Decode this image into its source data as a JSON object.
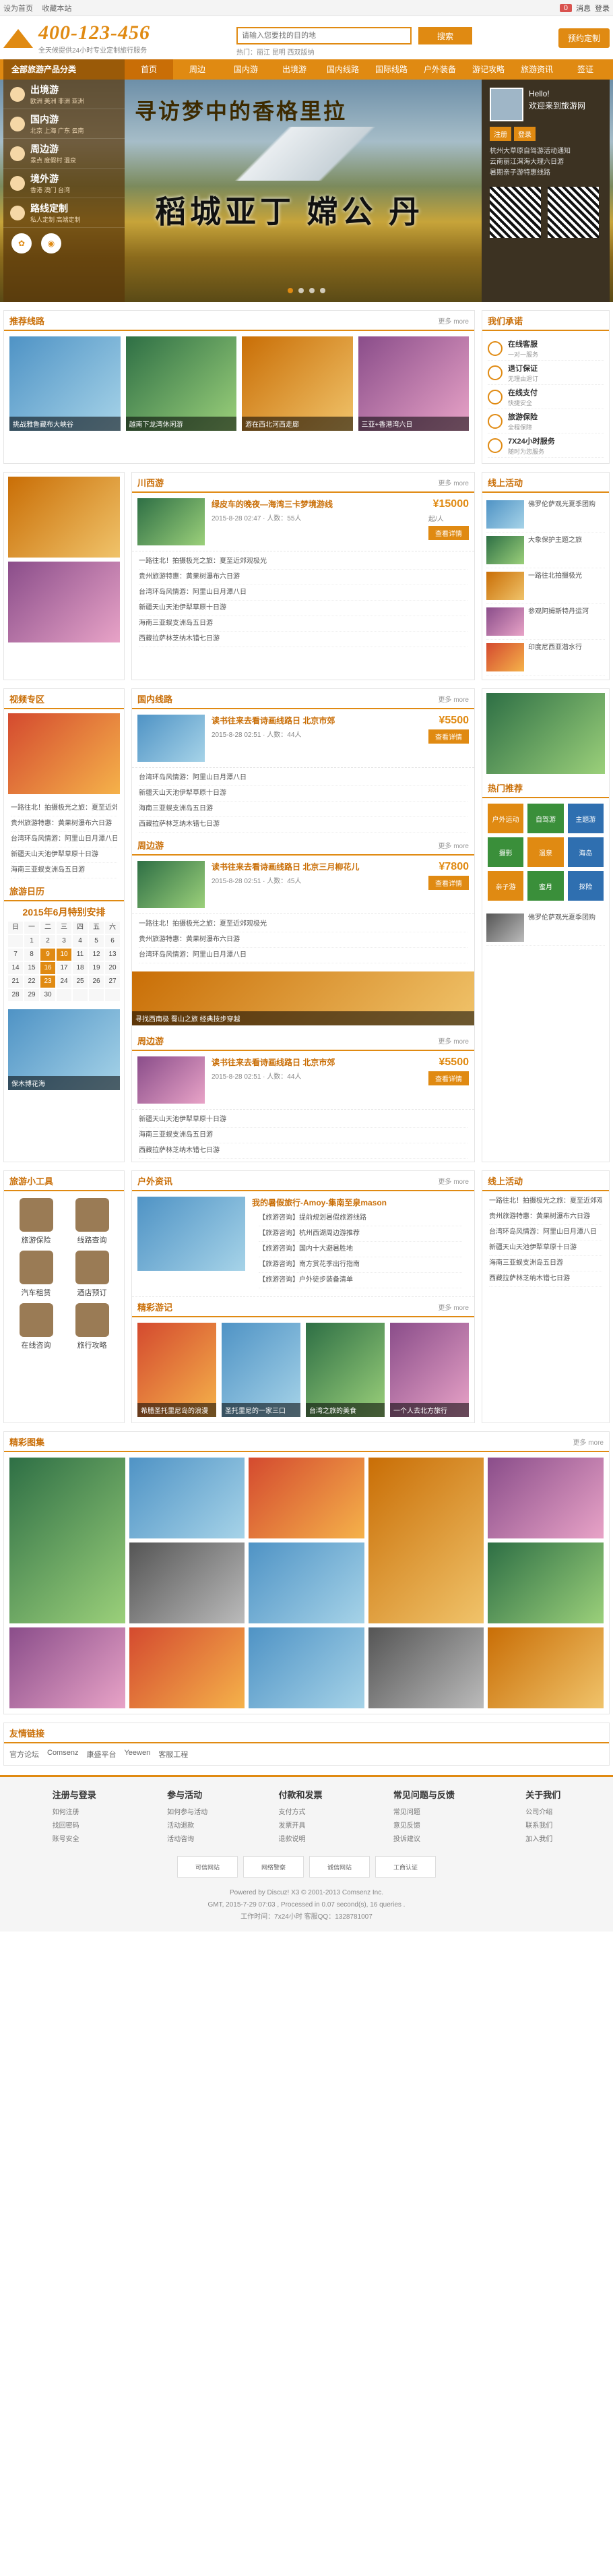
{
  "topbar": {
    "left": [
      "设为首页",
      "收藏本站"
    ],
    "user": "登录",
    "msg": "消息",
    "msgcount": "0"
  },
  "header": {
    "phone": "400-123-456",
    "phone_sub": "全天候提供24小时专业定制旅行服务",
    "search_placeholder": "请输入您要找的目的地",
    "search_btn": "搜索",
    "hot": "热门：丽江 昆明 西双版纳",
    "cta": "预约定制"
  },
  "nav": {
    "category": "全部旅游产品分类",
    "items": [
      "首页",
      "周边",
      "国内游",
      "出境游",
      "国内线路",
      "国际线路",
      "户外装备",
      "游记攻略",
      "旅游资讯",
      "签证"
    ]
  },
  "banner": {
    "text1": "寻访梦中的香格里拉",
    "text2": "稻城亚丁 嫦公 丹"
  },
  "sidecat": [
    {
      "t": "出境游",
      "s": "欧洲 美洲 非洲 亚洲"
    },
    {
      "t": "国内游",
      "s": "北京 上海 广东 云南"
    },
    {
      "t": "周边游",
      "s": "景点 度假村 温泉"
    },
    {
      "t": "境外游",
      "s": "香港 澳门 台湾"
    },
    {
      "t": "路线定制",
      "s": "私人定制 高端定制"
    }
  ],
  "login": {
    "hello": "Hello!",
    "welcome": "欢迎来到旅游网",
    "btns": [
      "注册",
      "登录"
    ],
    "news": [
      "杭州大草原自驾游活动通知",
      "云南丽江洱海大理六日游",
      "暑期亲子游特惠线路"
    ]
  },
  "tour_section": {
    "title": "推荐线路",
    "more": "更多 more",
    "items": [
      "挑战雅鲁藏布大峡谷",
      "越南下龙湾休闲游",
      "游在西北河西走廊",
      "三亚+香港湾六日"
    ]
  },
  "service": {
    "title": "我们承诺",
    "items": [
      {
        "t": "在线客服",
        "s": "一对一服务"
      },
      {
        "t": "退订保证",
        "s": "无理由退订"
      },
      {
        "t": "在线支付",
        "s": "快捷安全"
      },
      {
        "t": "旅游保险",
        "s": "全程保障"
      },
      {
        "t": "7X24小时服务",
        "s": "随时为您服务"
      }
    ]
  },
  "products": [
    {
      "title": "绿皮车的晚夜—海湾三卡梦境游线",
      "date": "2015-8-28 02:47",
      "people": "人数：55人",
      "price": "¥15000",
      "price_unit": "起/人",
      "btn": "查看详情",
      "tab": "川西游"
    },
    {
      "title": "读书往来去看诗画线路日 北京市郊",
      "date": "2015-8-28 02:51",
      "people": "人数：44人",
      "price": "¥5500",
      "price_unit": "起/人",
      "btn": "查看详情",
      "tab": "国内线路"
    },
    {
      "title": "读书往来去看诗画线路日 北京三月柳花儿",
      "date": "2015-8-28 02:51",
      "people": "人数：45人",
      "price": "¥7800",
      "price_unit": "起/人",
      "btn": "查看详情",
      "tab": "周边游"
    },
    {
      "title": "读书往来去看诗画线路日 北京市郊",
      "date": "2015-8-28 02:51",
      "people": "人数：44人",
      "price": "¥5500",
      "price_unit": "起/人",
      "btn": "查看详情",
      "tab": "周边游"
    }
  ],
  "list_lines": [
    "一路往北！拍摄极光之旅：夏至近郊观极光",
    "贵州旅游特惠：黄果树瀑布六日游",
    "台湾环岛风情游：阿里山日月潭八日",
    "新疆天山天池伊犁草原十日游",
    "海南三亚蜈支洲岛五日游",
    "西藏拉萨林芝纳木错七日游"
  ],
  "online_activity": {
    "title": "线上活动",
    "items": [
      "佛罗伦萨观光夏季团购",
      "大象保护主题之旅",
      "一路往北拍摄极光",
      "参观阿姆斯特丹运河",
      "印度尼西亚潜水行"
    ]
  },
  "left_panel": {
    "title": "视频专区",
    "cal_title": "旅游日历",
    "month": "2015年6月特别安排",
    "days": [
      "日",
      "一",
      "二",
      "三",
      "四",
      "五",
      "六"
    ],
    "dates": [
      "",
      "1",
      "2",
      "3",
      "4",
      "5",
      "6",
      "7",
      "8",
      "9",
      "10",
      "11",
      "12",
      "13",
      "14",
      "15",
      "16",
      "17",
      "18",
      "19",
      "20",
      "21",
      "22",
      "23",
      "24",
      "25",
      "26",
      "27",
      "28",
      "29",
      "30",
      "",
      "",
      "",
      ""
    ],
    "banner": "保木博花海"
  },
  "promo_banner": "寻找西南极 蜀山之旅 经典技步穿越",
  "theme": {
    "title": "热门推荐",
    "items": [
      "户外运动",
      "自驾游",
      "主题游",
      "摄影",
      "温泉",
      "海岛",
      "亲子游",
      "蜜月",
      "探险"
    ]
  },
  "outdoor": {
    "title": "户外资讯",
    "feature": "我的暑假旅行-Amoy-集南至泉mason",
    "lines": [
      "【旅游咨询】提前规划暑假旅游线路",
      "【旅游咨询】杭州西湖周边游推荐",
      "【旅游咨询】国内十大避暑胜地",
      "【旅游咨询】南方赏花季出行指南",
      "【旅游咨询】户外徒步装备清单"
    ]
  },
  "tools": {
    "title": "旅游小工具",
    "items": [
      "旅游保险",
      "线路查询",
      "汽车租赁",
      "酒店预订",
      "在线咨询",
      "旅行攻略"
    ]
  },
  "note": {
    "title": "精彩游记",
    "items": [
      "希腊圣托里尼岛的浪漫",
      "圣托里尼的一家三口",
      "台湾之旅的美食",
      "一个人去北方旅行"
    ]
  },
  "gallery": {
    "title": "精彩图集",
    "more": "更多 more"
  },
  "friendlinks": {
    "title": "友情链接",
    "items": [
      "官方论坛",
      "Comsenz",
      "康盛平台",
      "Yeewen",
      "客服工程"
    ]
  },
  "footer": {
    "cols": [
      {
        "t": "注册与登录",
        "l": [
          "如何注册",
          "找回密码",
          "账号安全"
        ]
      },
      {
        "t": "参与活动",
        "l": [
          "如何参与活动",
          "活动退款",
          "活动咨询"
        ]
      },
      {
        "t": "付款和发票",
        "l": [
          "支付方式",
          "发票开具",
          "退款说明"
        ]
      },
      {
        "t": "常见问题与反馈",
        "l": [
          "常见问题",
          "意见反馈",
          "投诉建议"
        ]
      },
      {
        "t": "关于我们",
        "l": [
          "公司介绍",
          "联系我们",
          "加入我们"
        ]
      }
    ],
    "certs": [
      "可信网站",
      "网络警察",
      "诚信网站",
      "工商认证"
    ],
    "copy1": "Powered by Discuz! X3 © 2001-2013 Comsenz Inc.",
    "copy2": "GMT, 2015-7-29 07:03 , Processed in 0.07 second(s), 16 queries .",
    "copy3": "工作时间：7x24小时 客服QQ：1328781007"
  }
}
